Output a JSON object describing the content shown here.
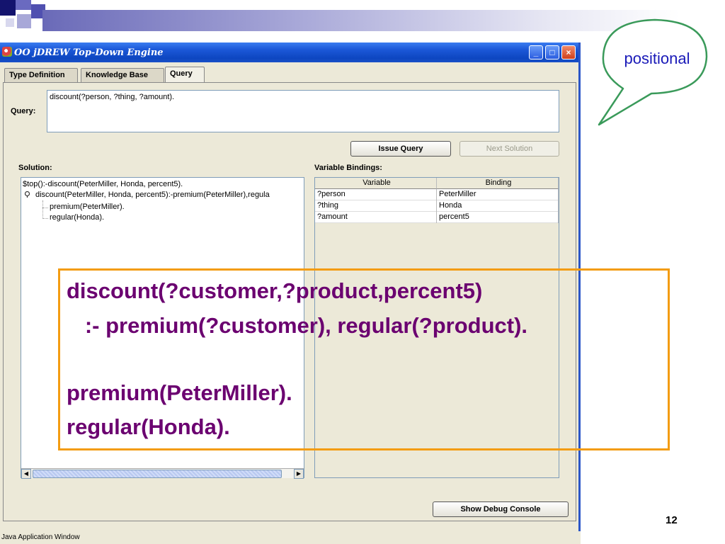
{
  "window": {
    "title": "OO jDREW Top-Down Engine",
    "minimize_label": "_",
    "maximize_label": "□",
    "close_label": "×"
  },
  "tabs": [
    {
      "label": "Type Definition",
      "active": false
    },
    {
      "label": "Knowledge Base",
      "active": false
    },
    {
      "label": "Query",
      "active": true
    }
  ],
  "query": {
    "label": "Query:",
    "value": "discount(?person, ?thing, ?amount)."
  },
  "buttons": {
    "issue_query": "Issue Query",
    "next_solution": "Next Solution",
    "show_debug_console": "Show Debug Console"
  },
  "solution": {
    "label": "Solution:",
    "lines": [
      "$top():-discount(PeterMiller, Honda, percent5).",
      "discount(PeterMiller, Honda, percent5):-premium(PeterMiller),regula",
      "premium(PeterMiller).",
      "regular(Honda)."
    ]
  },
  "variable_bindings": {
    "label": "Variable Bindings:",
    "columns": [
      "Variable",
      "Binding"
    ],
    "rows": [
      [
        "?person",
        "PeterMiller"
      ],
      [
        "?thing",
        "Honda"
      ],
      [
        "?amount",
        "percent5"
      ]
    ]
  },
  "status_bar": "Java Application Window",
  "rule_overlay": {
    "lines": [
      "discount(?customer,?product,percent5)",
      "   :- premium(?customer), regular(?product).",
      "premium(PeterMiller).",
      "regular(Honda)."
    ],
    "text_color": "#6b0070",
    "border_color": "#f39c12"
  },
  "callout": {
    "text": "positional",
    "border_color": "#3a9a5a",
    "text_color": "#1a1ab8"
  },
  "slide_number": "12",
  "colors": {
    "title_bar": "#1c58d8",
    "window_bg": "#ece9d8"
  }
}
